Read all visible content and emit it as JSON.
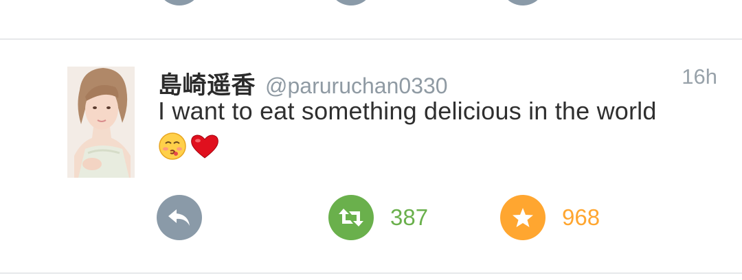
{
  "tweet": {
    "display_name": "島崎遥香",
    "handle": "@paruruchan0330",
    "time": "16h",
    "text": "I want to eat something delicious in the world",
    "emoji": [
      "kissing-face-emoji",
      "red-heart-emoji"
    ],
    "actions": {
      "reply": {
        "icon": "reply-icon",
        "color": "#8a9aa8"
      },
      "retweet": {
        "icon": "retweet-icon",
        "count": "387",
        "color": "#6ab04c"
      },
      "favorite": {
        "icon": "star-icon",
        "count": "968",
        "color": "#ffa630"
      }
    }
  }
}
